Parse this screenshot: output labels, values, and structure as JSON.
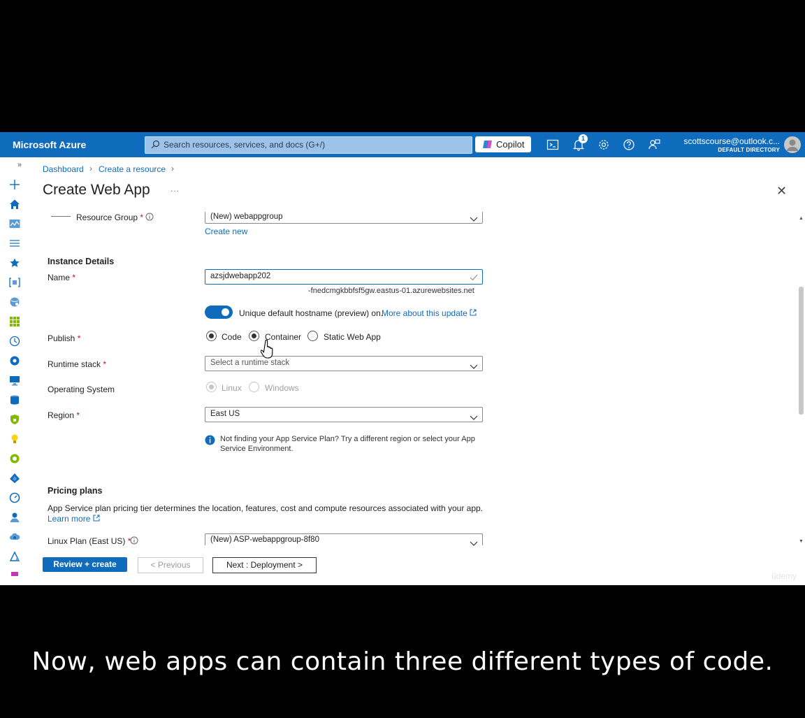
{
  "topbar": {
    "brand": "Microsoft Azure",
    "search_placeholder": "Search resources, services, and docs (G+/)",
    "copilot_label": "Copilot",
    "notification_count": "1",
    "account_email": "scottscourse@outlook.c...",
    "account_directory": "DEFAULT DIRECTORY"
  },
  "breadcrumb": {
    "items": [
      "Dashboard",
      "Create a resource"
    ]
  },
  "page": {
    "title": "Create Web App",
    "more": "...",
    "close": "✕"
  },
  "form": {
    "resource_group_label": "Resource Group",
    "resource_group_value": "(New) webappgroup",
    "create_new_link": "Create new",
    "instance_details_heading": "Instance Details",
    "name_label": "Name",
    "name_value": "azsjdwebapp202",
    "hostname_suffix": "-fnedcmgkbbfsf5gw.eastus-01.azurewebsites.net",
    "hostname_toggle_text": "Unique default hostname (preview) on.",
    "hostname_toggle_link": "More about this update",
    "publish_label": "Publish",
    "publish_options": [
      "Code",
      "Container",
      "Static Web App"
    ],
    "publish_selected": "Code",
    "runtime_label": "Runtime stack",
    "runtime_placeholder": "Select a runtime stack",
    "os_label": "Operating System",
    "os_options": [
      "Linux",
      "Windows"
    ],
    "os_selected": "Linux",
    "region_label": "Region",
    "region_value": "East US",
    "region_info": "Not finding your App Service Plan? Try a different region or select your App",
    "region_info_line2": "Service Environment.",
    "pricing_heading": "Pricing plans",
    "pricing_desc": "App Service plan pricing tier determines the location, features, cost and compute resources associated with your app.",
    "learn_more_link": "Learn more",
    "linux_plan_label": "Linux Plan (East US)",
    "linux_plan_value": "(New) ASP-webappgroup-8f80",
    "required_mark": "*"
  },
  "footer": {
    "review_create": "Review + create",
    "previous": "< Previous",
    "next": "Next : Deployment >"
  },
  "watermark": "ûdemy",
  "caption": "Now, web apps can contain three different types of code.",
  "colors": {
    "azure_blue": "#0f6cbd",
    "toggle_on": "#0f6cbd"
  }
}
